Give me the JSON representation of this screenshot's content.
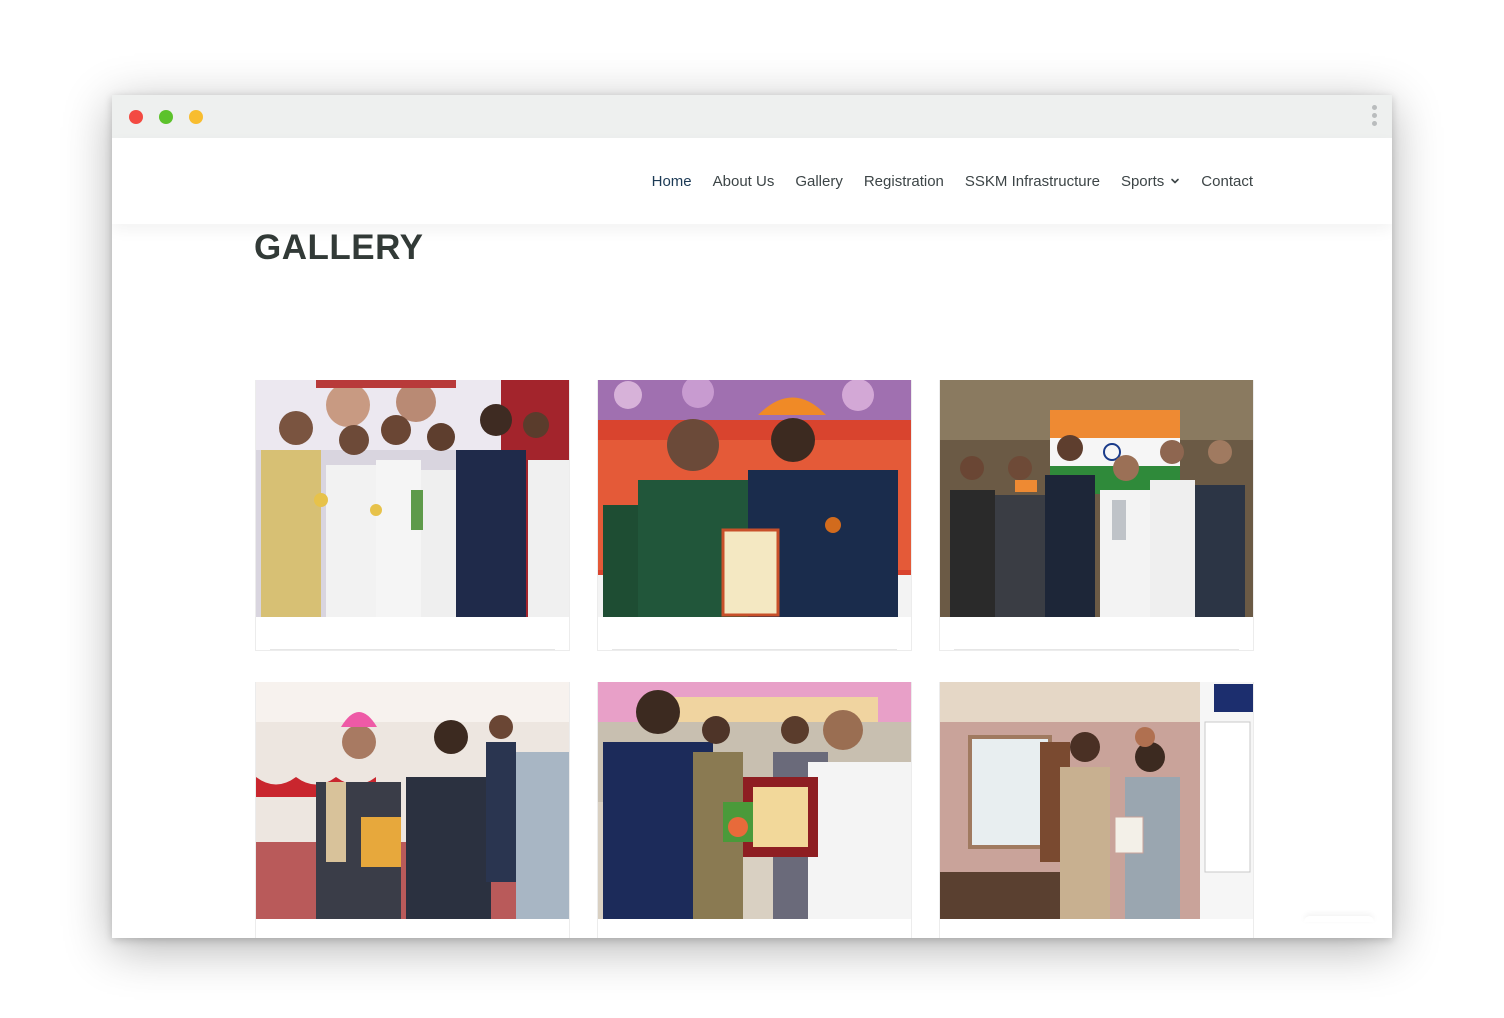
{
  "window": {
    "controls": [
      "close",
      "minimize",
      "maximize"
    ],
    "menu_icon": "kebab-vertical-icon"
  },
  "nav": {
    "items": [
      {
        "label": "Home",
        "active": true
      },
      {
        "label": "About Us"
      },
      {
        "label": "Gallery"
      },
      {
        "label": "Registration"
      },
      {
        "label": "SSKM Infrastructure"
      },
      {
        "label": "Sports",
        "has_dropdown": true
      },
      {
        "label": "Contact"
      }
    ],
    "dropdown_icon": "chevron-down-icon"
  },
  "page": {
    "title": "GALLERY"
  },
  "gallery": {
    "photos": [
      {
        "scene": "award-ceremony-group"
      },
      {
        "scene": "certificate-presentation"
      },
      {
        "scene": "flag-trophy-group"
      },
      {
        "scene": "book-presentation"
      },
      {
        "scene": "plaque-presentation"
      },
      {
        "scene": "office-certificate"
      }
    ]
  },
  "colors": {
    "nav_text": "#3d4547",
    "nav_active": "#1c3a55",
    "title": "#323a37",
    "titlebar": "#eef0ef",
    "dot_red": "#f34a42",
    "dot_green": "#5cc22b",
    "dot_yellow": "#f8bd2f"
  }
}
